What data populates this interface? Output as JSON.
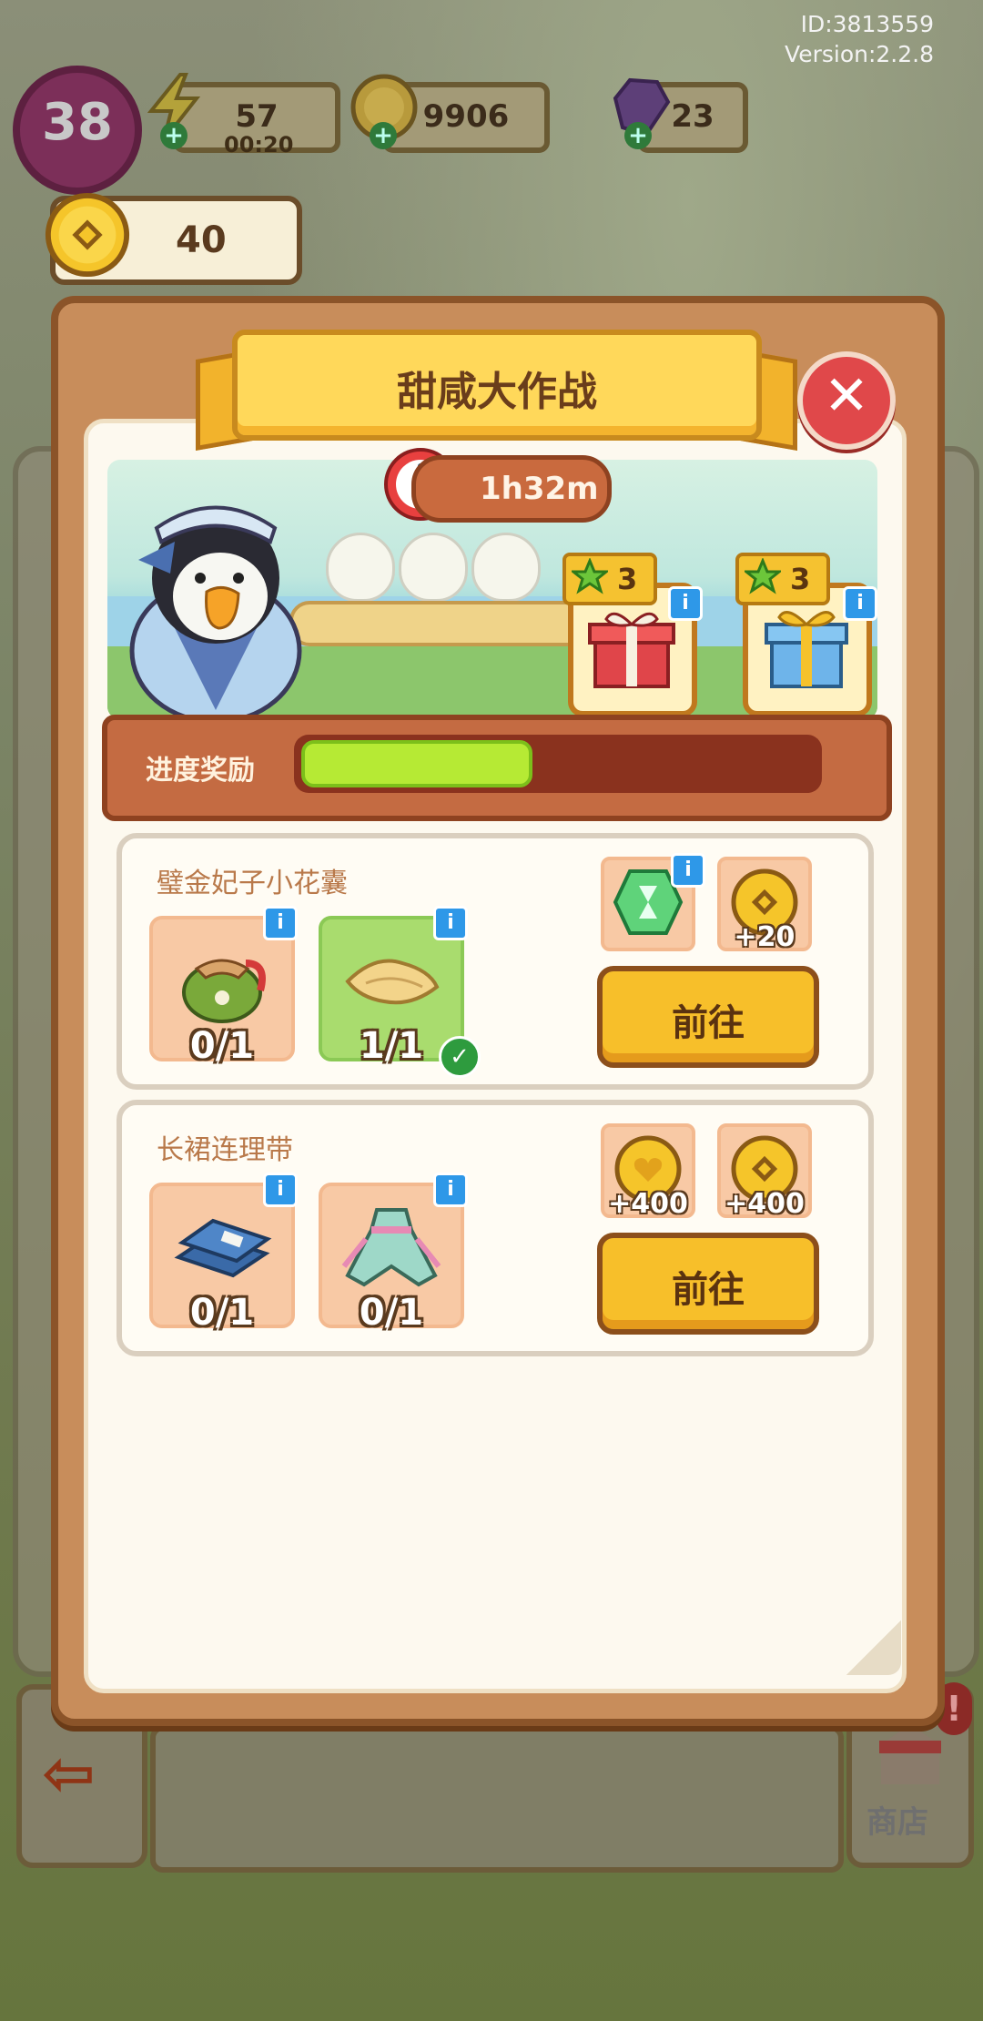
{
  "debug": {
    "id": "ID:3813559",
    "version": "Version:2.2.8"
  },
  "hud": {
    "level": "38",
    "energy": "57",
    "energy_timer": "00:20",
    "coins": "9906",
    "gems": "23",
    "event_coins": "40"
  },
  "panel": {
    "title": "甜咸大作战",
    "timer": "1h32m",
    "progress_label": "进度奖励",
    "progress_fraction": 0.45,
    "milestones": [
      {
        "stars": "3",
        "reward_icon": "red-gift-box-icon"
      },
      {
        "stars": "3",
        "reward_icon": "blue-gift-box-icon"
      }
    ]
  },
  "quests": [
    {
      "title": "璧金妃子小花囊",
      "items": [
        {
          "icon": "green-pouch-icon",
          "count": "0/1",
          "done": false
        },
        {
          "icon": "silk-cloth-icon",
          "count": "1/1",
          "done": true
        }
      ],
      "rewards": [
        {
          "icon": "green-hourglass-gem-icon",
          "amount": ""
        },
        {
          "icon": "gold-coin-icon",
          "amount": "+20"
        }
      ],
      "button": "前往"
    },
    {
      "title": "长裙连理带",
      "items": [
        {
          "icon": "blue-books-icon",
          "count": "0/1",
          "done": false
        },
        {
          "icon": "hanfu-dress-icon",
          "count": "0/1",
          "done": false
        }
      ],
      "rewards": [
        {
          "icon": "gold-heart-coin-icon",
          "amount": "+400"
        },
        {
          "icon": "gold-coin-icon",
          "amount": "+400"
        }
      ],
      "button": "前往"
    }
  ],
  "background": {
    "shop_label": "商店",
    "shop_alert": "!"
  },
  "colors": {
    "panel_frame": "#8b5429",
    "banner_yellow": "#ffd85a",
    "button_yellow": "#f7bf2a",
    "progress_green": "#b6ea34",
    "close_red": "#e0484a",
    "info_blue": "#2e98e8"
  }
}
